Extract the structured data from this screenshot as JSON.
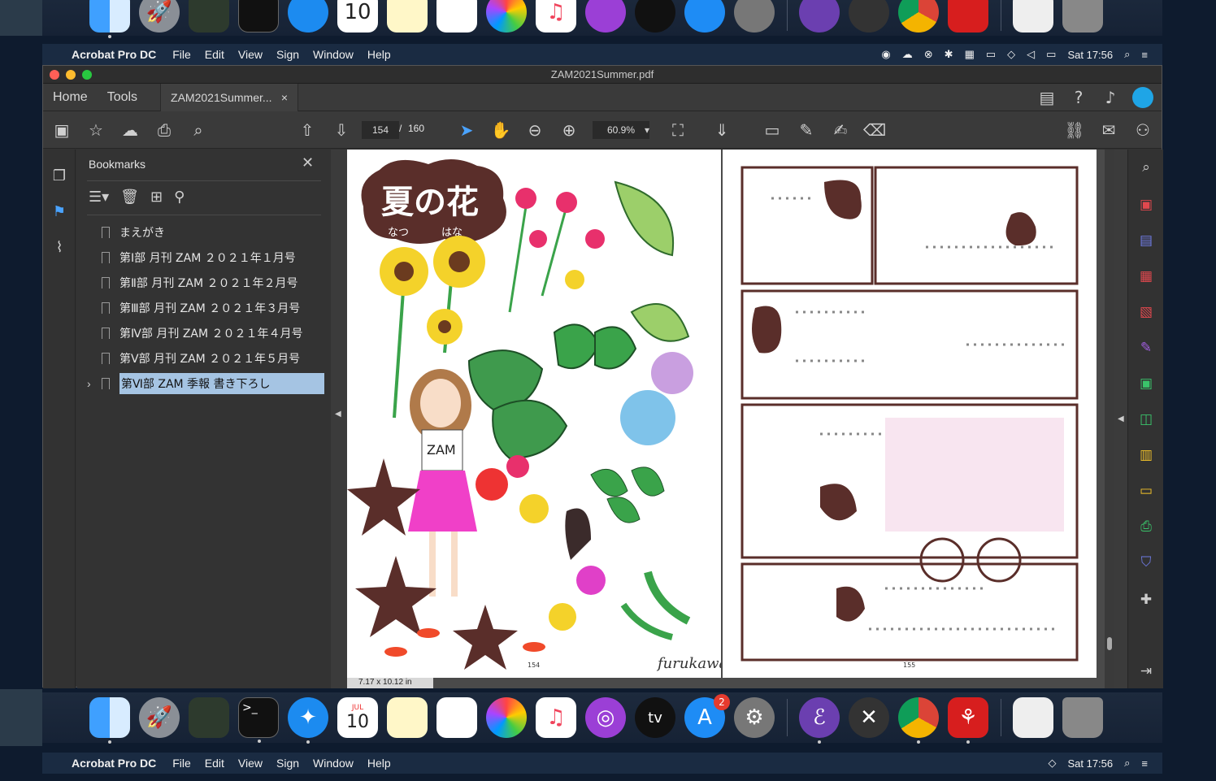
{
  "dock": {
    "calendar_day": "10",
    "calendar_month": "JUL",
    "appstore_badge": "2",
    "apps": [
      "finder-icon",
      "launchpad-icon",
      "migration-icon",
      "terminal-icon",
      "safari-icon",
      "calendar-icon",
      "notes-icon",
      "reminders-icon",
      "photos-icon",
      "music-icon",
      "podcasts-icon",
      "appletv-icon",
      "appstore-icon",
      "system-preferences-icon",
      "emacs-icon",
      "xquartz-icon",
      "chrome-icon",
      "acrobat-icon",
      "document-stack-icon",
      "trash-icon"
    ],
    "appletv_label": "tv"
  },
  "menubar": {
    "app_name": "Acrobat Pro DC",
    "items": [
      "File",
      "Edit",
      "View",
      "Sign",
      "Window",
      "Help"
    ],
    "clock": "Sat 17:56"
  },
  "window": {
    "title": "ZAM2021Summer.pdf",
    "tabs": {
      "home": "Home",
      "tools": "Tools",
      "doc": "ZAM2021Summer...",
      "close": "×"
    },
    "toolbar": {
      "page_current": "154",
      "page_sep": "/",
      "page_total": "160",
      "zoom": "60.9%"
    },
    "bookmarks": {
      "title": "Bookmarks",
      "items": [
        "まえがき",
        "第Ⅰ部 月刊 ZAM ２０２１年１月号",
        "第Ⅱ部 月刊 ZAM ２０２１年２月号",
        "第Ⅲ部 月刊 ZAM ２０２１年３月号",
        "第Ⅳ部 月刊 ZAM ２０２１年４月号",
        "第Ⅴ部 月刊 ZAM ２０２１年５月号",
        "第Ⅵ部 ZAM 季報 書き下ろし"
      ]
    },
    "page_left": {
      "title": "夏の花",
      "ruby1": "なつ",
      "ruby2": "はな",
      "shirt": "ZAM",
      "signature": "furukawa",
      "page_no": "154"
    },
    "page_right": {
      "page_no": "155"
    },
    "page_size": "7.17 x 10.12 in"
  },
  "colors": {
    "accent": "#1473e6",
    "selection": "#a5c4e3"
  }
}
